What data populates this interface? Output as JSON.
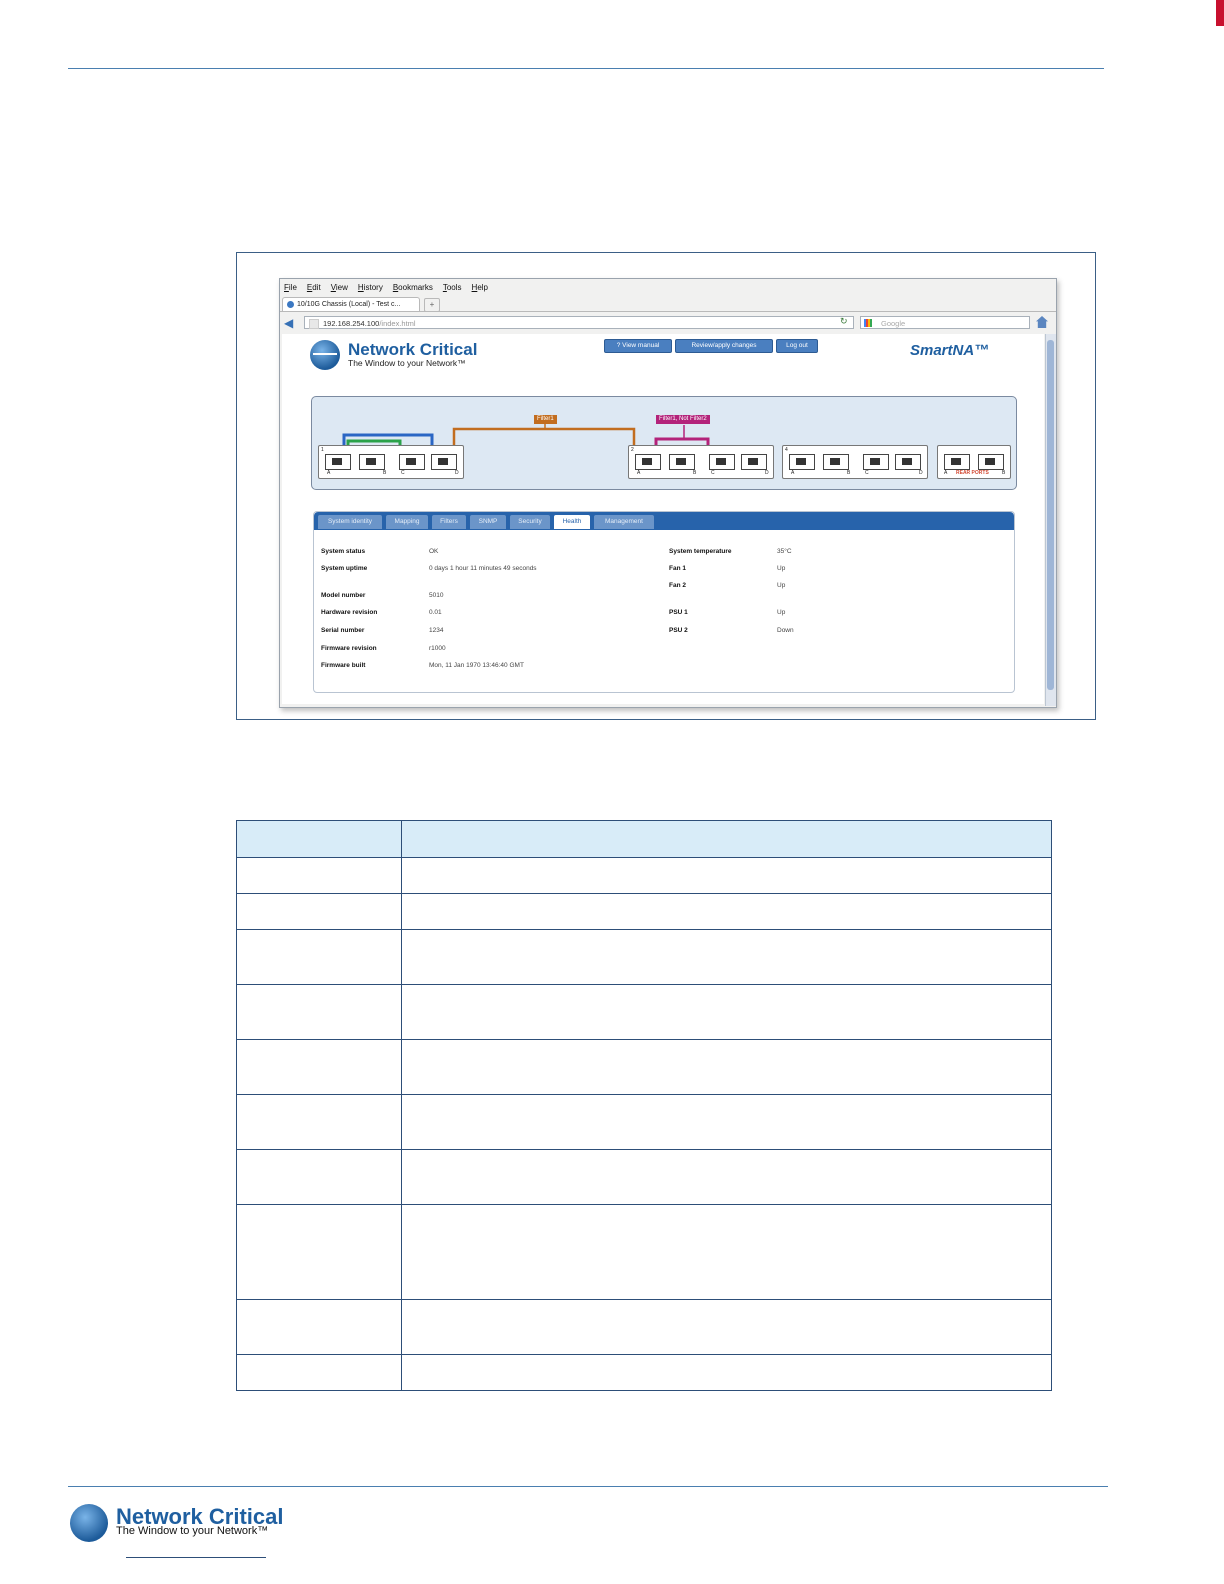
{
  "browser": {
    "menu": [
      "File",
      "Edit",
      "View",
      "History",
      "Bookmarks",
      "Tools",
      "Help"
    ],
    "tab_title": "10/10G Chassis (Local) - Test c...",
    "new_tab": "+",
    "url_host": "192.168.254.100",
    "url_path": "/index.html",
    "search_placeholder": "Google"
  },
  "app": {
    "brand": "Network Critical",
    "tagline": "The Window to your Network™",
    "product": "SmartNA™",
    "buttons": {
      "view_manual": "?  View manual",
      "review": "Review/apply changes",
      "logout": "Log out"
    }
  },
  "diagram": {
    "filter_left": "Filter1",
    "filter_right": "Filter1, Not Filter2",
    "modules": [
      {
        "number": "1",
        "ports": [
          "A",
          "B",
          "C",
          "D"
        ]
      },
      {
        "number": "2",
        "ports": [
          "A",
          "B",
          "C",
          "D"
        ]
      },
      {
        "number": "4",
        "ports": [
          "A",
          "B",
          "C",
          "D"
        ]
      }
    ],
    "rear": {
      "ports": [
        "A",
        "B"
      ],
      "label": "REAR PORTS"
    }
  },
  "tabs": [
    "System identity",
    "Mapping",
    "Filters",
    "SNMP",
    "Security",
    "Health",
    "Management"
  ],
  "active_tab": "Health",
  "health": {
    "left": [
      {
        "k": "System status",
        "v": "OK"
      },
      {
        "k": "System uptime",
        "v": "0 days 1 hour 11 minutes 49 seconds"
      },
      {
        "k": "Model number",
        "v": "5010"
      },
      {
        "k": "Hardware revision",
        "v": "0.01"
      },
      {
        "k": "Serial number",
        "v": "1234"
      },
      {
        "k": "Firmware revision",
        "v": "r1000"
      },
      {
        "k": "Firmware built",
        "v": "Mon, 11 Jan 1970 13:46:40 GMT"
      }
    ],
    "right": [
      {
        "k": "System temperature",
        "v": "35°C"
      },
      {
        "k": "Fan 1",
        "v": "Up"
      },
      {
        "k": "Fan 2",
        "v": "Up"
      },
      {
        "k": "PSU 1",
        "v": "Up"
      },
      {
        "k": "PSU 2",
        "v": "Down"
      }
    ]
  },
  "footer": {
    "brand": "Network Critical",
    "tagline": "The Window to your Network™"
  },
  "table": {
    "rows": 10
  }
}
